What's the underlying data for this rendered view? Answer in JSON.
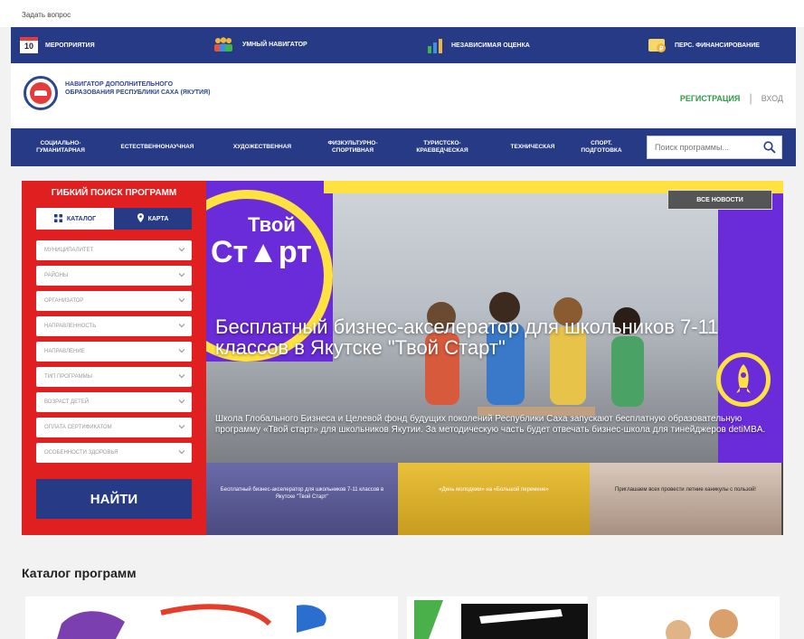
{
  "ask": "Задать вопрос",
  "topnav": [
    {
      "icon": "calendar-icon",
      "label": "Мероприятия",
      "badge": "10"
    },
    {
      "icon": "people-icon",
      "label": "Умный навигатор"
    },
    {
      "icon": "chart-icon",
      "label": "Независимая оценка"
    },
    {
      "icon": "money-icon",
      "label": "Перс. финансирование"
    }
  ],
  "header": {
    "logo_text": "Навигатор дополнительного образования Республики Саха (Якутия)",
    "register": "Регистрация",
    "separator": "|",
    "login": "Вход"
  },
  "categories": [
    "Социально-гуманитарная",
    "Естественнонаучная",
    "Художественная",
    "Физкультурно-спортивная",
    "Туристско-краеведческая",
    "Техническая",
    "Спорт. подготовка"
  ],
  "search": {
    "placeholder": "Поиск программы..."
  },
  "filter": {
    "title": "Гибкий поиск программ",
    "tab_catalog": "Каталог",
    "tab_map": "Карта",
    "selects": [
      "Муниципалитет",
      "Районы",
      "Организатор",
      "Направленность",
      "Направление",
      "Тип программы",
      "Возраст детей",
      "Оплата сертификатом",
      "Особенности здоровья"
    ],
    "find": "Найти"
  },
  "hero": {
    "tvoy": "Твой",
    "start": "Ст▲рт",
    "all_news": "Все новости",
    "title": "Бесплатный бизнес-акселератор для школьников 7-11 классов в Якутске \"Твой Старт\"",
    "desc": "Школа Глобального Бизнеса и Целевой фонд будущих поколений Республики Саха запускают бесплатную образовательную программу «Твой старт» для школьников Якутии. За методическую часть будет отвечать бизнес-школа для тинейджеров detiMBA.",
    "thumbs": [
      "Бесплатный бизнес-акселератор для школьников 7-11 классов в Якутске \"Твой Старт\"",
      "«День молодежи» на «Большой перемене»",
      "Приглашаем всех провести летние каникулы с пользой!"
    ]
  },
  "catalog_title": "Каталог программ",
  "colors": {
    "navy": "#263a86",
    "red": "#e02020",
    "green": "#2f9a47",
    "purple": "#6a2bd9",
    "yellow": "#ffe23f"
  }
}
